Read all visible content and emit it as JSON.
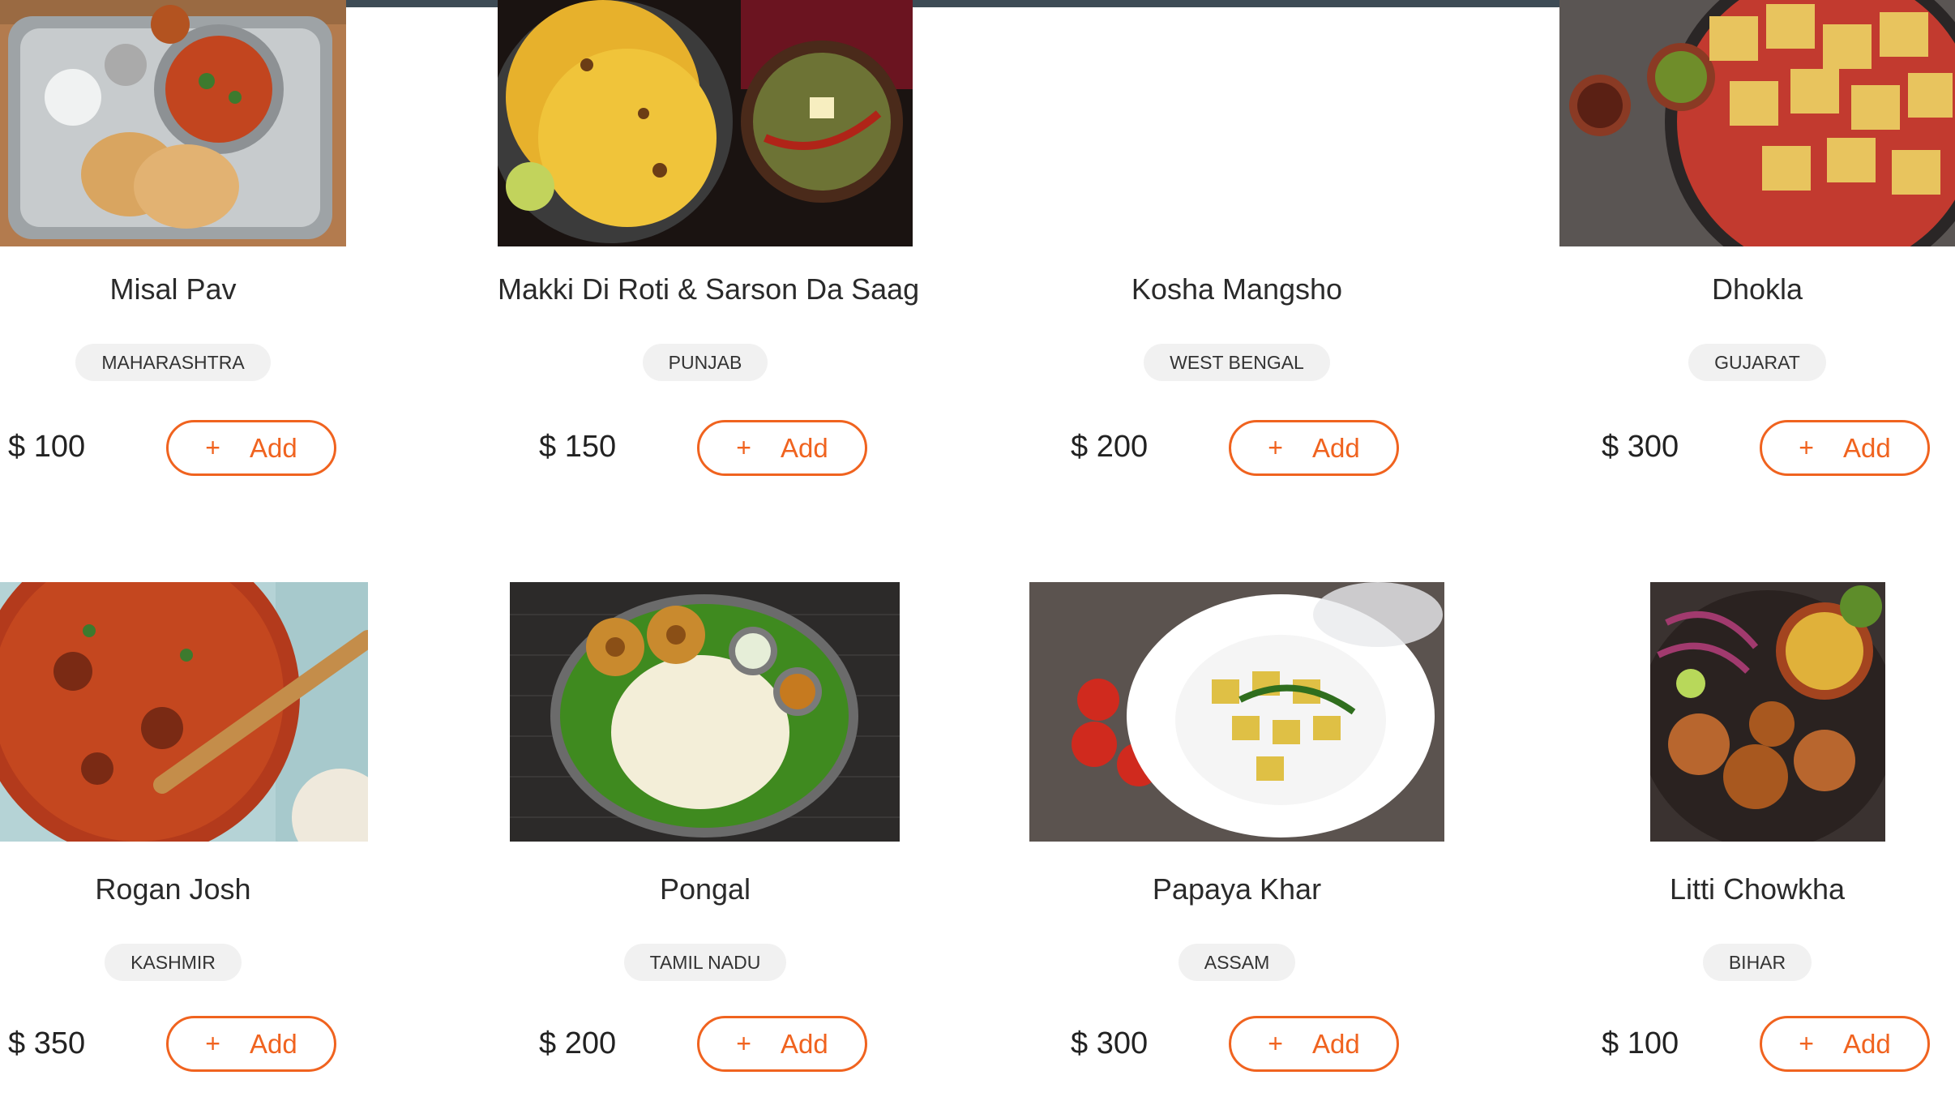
{
  "header": {
    "bar_color": "#3d4b55"
  },
  "accent_color": "#f0631f",
  "dishes": [
    {
      "name": "Misal Pav",
      "region": "MAHARASHTRA",
      "price": "$ 100",
      "add_label": "Add",
      "add_icon": "+",
      "image": "misal-pav-photo"
    },
    {
      "name": "Makki Di Roti & Sarson Da Saag",
      "region": "PUNJAB",
      "price": "$ 150",
      "add_label": "Add",
      "add_icon": "+",
      "image": "makki-roti-saag-photo"
    },
    {
      "name": "Kosha Mangsho",
      "region": "WEST BENGAL",
      "price": "$ 200",
      "add_label": "Add",
      "add_icon": "+",
      "image": ""
    },
    {
      "name": "Dhokla",
      "region": "GUJARAT",
      "price": "$ 300",
      "add_label": "Add",
      "add_icon": "+",
      "image": "dhokla-photo"
    },
    {
      "name": "Rogan Josh",
      "region": "KASHMIR",
      "price": "$ 350",
      "add_label": "Add",
      "add_icon": "+",
      "image": "rogan-josh-photo"
    },
    {
      "name": "Pongal",
      "region": "TAMIL NADU",
      "price": "$ 200",
      "add_label": "Add",
      "add_icon": "+",
      "image": "pongal-photo"
    },
    {
      "name": "Papaya Khar",
      "region": "ASSAM",
      "price": "$ 300",
      "add_label": "Add",
      "add_icon": "+",
      "image": "papaya-khar-photo"
    },
    {
      "name": "Litti Chowkha",
      "region": "BIHAR",
      "price": "$ 100",
      "add_label": "Add",
      "add_icon": "+",
      "image": "litti-chowkha-photo"
    }
  ]
}
